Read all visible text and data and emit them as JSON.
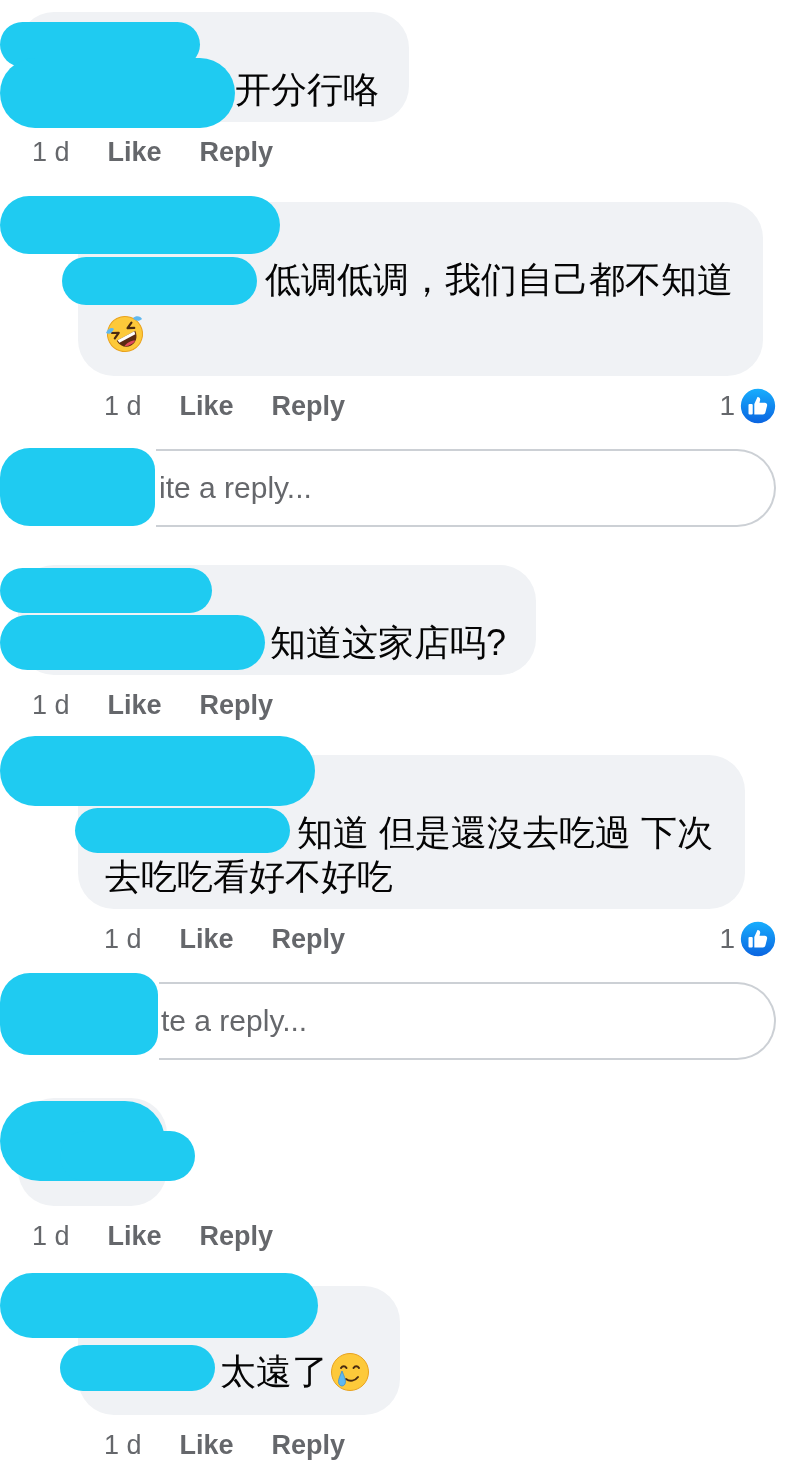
{
  "thread": [
    {
      "kind": "comment",
      "redacted": true,
      "text": "开分行咯",
      "time": "1 d",
      "actions": [
        "Like",
        "Reply"
      ]
    },
    {
      "kind": "reply",
      "redacted": true,
      "text": "低调低调，我们自己都不知道",
      "emoji": {
        "kind": "rofl"
      },
      "time": "1 d",
      "actions": [
        "Like",
        "Reply"
      ],
      "reactions": {
        "kind": "like",
        "count": "1"
      }
    },
    {
      "kind": "reply_box",
      "redacted": true,
      "placeholder": "ite a reply..."
    },
    {
      "kind": "comment",
      "redacted": true,
      "text": "知道这家店吗?",
      "time": "1 d",
      "actions": [
        "Like",
        "Reply"
      ]
    },
    {
      "kind": "reply",
      "redacted": true,
      "text": "知道 但是還沒去吃過 下次去吃吃看好不好吃",
      "time": "1 d",
      "actions": [
        "Like",
        "Reply"
      ],
      "reactions": {
        "kind": "like",
        "count": "1"
      }
    },
    {
      "kind": "reply_box",
      "redacted": true,
      "placeholder": "te a reply..."
    },
    {
      "kind": "comment",
      "redacted": true,
      "time": "1 d",
      "actions": [
        "Like",
        "Reply"
      ]
    },
    {
      "kind": "reply",
      "redacted": true,
      "text": "太遠了",
      "emoji": {
        "kind": "smile_tear"
      },
      "time": "1 d",
      "actions": [
        "Like",
        "Reply"
      ]
    }
  ]
}
